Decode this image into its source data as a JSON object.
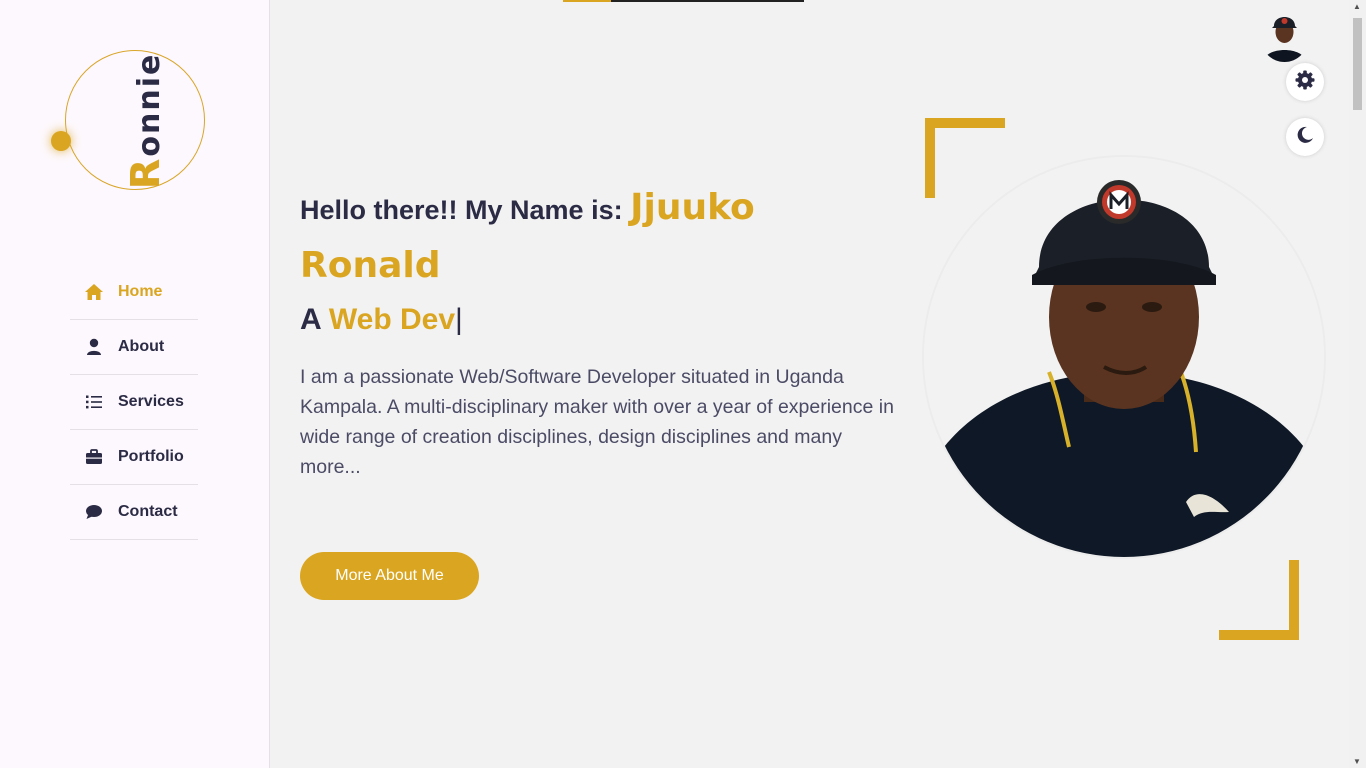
{
  "sidebar": {
    "logo": {
      "first_letter": "R",
      "rest": "onnie"
    },
    "nav": [
      {
        "label": "Home",
        "icon": "home-icon",
        "active": true
      },
      {
        "label": "About",
        "icon": "user-icon",
        "active": false
      },
      {
        "label": "Services",
        "icon": "list-icon",
        "active": false
      },
      {
        "label": "Portfolio",
        "icon": "briefcase-icon",
        "active": false
      },
      {
        "label": "Contact",
        "icon": "chat-icon",
        "active": false
      }
    ]
  },
  "hero": {
    "greeting_prefix": "Hello there!! My Name is: ",
    "name": "Jjuuko Ronald",
    "role_prefix": "A ",
    "role": "Web Dev",
    "role_cursor": "|",
    "bio": "I am a passionate Web/Software Developer situated in Uganda Kampala. A multi-disciplinary maker with over a year of experience in wide range of creation disciplines, design disciplines and many more...",
    "button_label": "More About Me"
  },
  "scroll_progress": 0.2,
  "colors": {
    "accent": "#daa520",
    "text_dark": "#2b2b45",
    "text_body": "#4b4b66",
    "sidebar_bg": "#fdf8fd",
    "page_bg": "#f2f2f2"
  },
  "icons": {
    "settings": "gear-icon",
    "theme": "moon-icon",
    "profile": "avatar"
  }
}
